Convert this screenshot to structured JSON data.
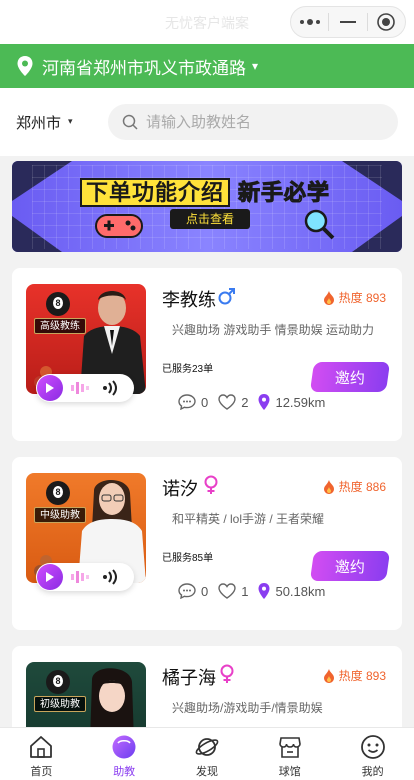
{
  "header": {
    "title": "无忧客户端案",
    "home_icon": "home-icon",
    "capsule_icons": [
      "more-dots-icon",
      "minimize-icon",
      "record-icon"
    ]
  },
  "location": {
    "address": "河南省郑州市巩义市政通路",
    "caret": "▾",
    "icon": "location-pin-icon"
  },
  "search": {
    "city": "郑州市",
    "city_caret": "▾",
    "placeholder": "请输入助教姓名",
    "value": ""
  },
  "banner": {
    "title_part1": "下单功能介绍",
    "title_part2": "新手必学",
    "cta": "点击查看"
  },
  "coaches": [
    {
      "rank": "高级教练",
      "name": "李教练",
      "gender": "male",
      "hot_label": "热度",
      "hot_value": "893",
      "tags": "兴趣助场 游戏助手 情景助娱 运动助力",
      "served": "已服务23单",
      "invite": "邀约",
      "comments": "0",
      "likes": "2",
      "distance": "12.59km"
    },
    {
      "rank": "中级助教",
      "name": "诺汐",
      "gender": "female",
      "hot_label": "热度",
      "hot_value": "886",
      "tags": "和平精英 / lol手游 / 王者荣耀",
      "served": "已服务85单",
      "invite": "邀约",
      "comments": "0",
      "likes": "1",
      "distance": "50.18km"
    },
    {
      "rank": "初级助教",
      "name": "橘子海",
      "gender": "female",
      "hot_label": "热度",
      "hot_value": "893",
      "tags": "兴趣助场/游戏助手/情景助娱"
    }
  ],
  "tabs": [
    {
      "label": "首页",
      "icon": "home-icon"
    },
    {
      "label": "助教",
      "icon": "coach-icon",
      "active": true
    },
    {
      "label": "发现",
      "icon": "planet-icon"
    },
    {
      "label": "球馆",
      "icon": "shop-icon"
    },
    {
      "label": "我的",
      "icon": "smile-icon"
    }
  ],
  "colors": {
    "location_bar": "#4cba55",
    "accent_purple": "#8a3df0",
    "hot_orange": "#f0642e",
    "male_blue": "#3a7bf0",
    "female_pink": "#e840c8"
  }
}
